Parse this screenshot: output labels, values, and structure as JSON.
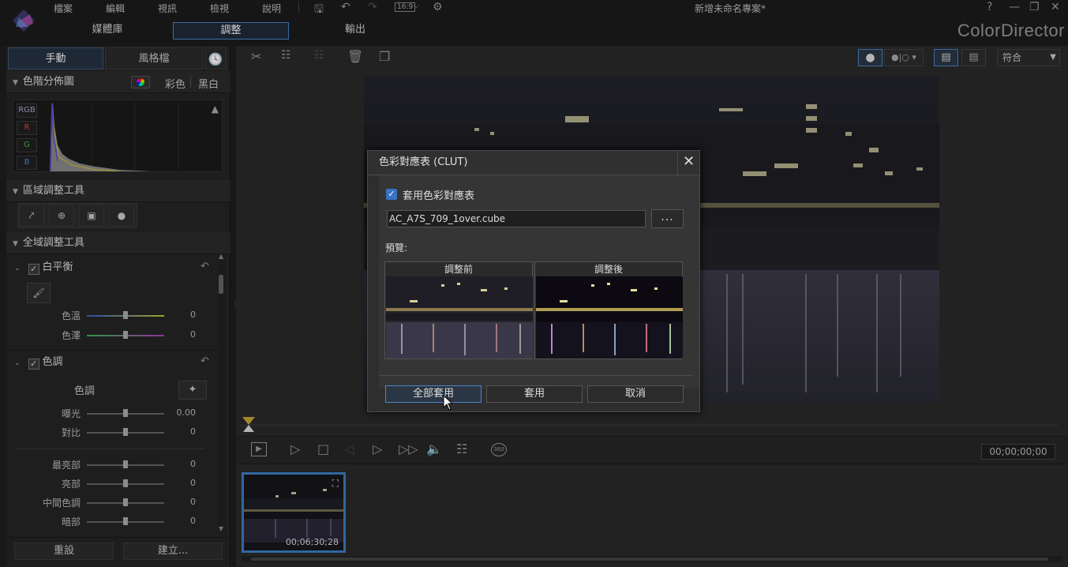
{
  "menu": [
    "檔案",
    "編輯",
    "視訊",
    "檢視",
    "說明"
  ],
  "toolbar_ratio": "16:9",
  "window_title": "新增未命名專案*",
  "window_controls": {
    "help": "?"
  },
  "main_tabs": [
    "媒體庫",
    "調整",
    "輸出"
  ],
  "brand": "ColorDirector",
  "left_tabs": [
    "手動",
    "風格檔"
  ],
  "histogram": {
    "title": "色階分佈圖",
    "mode_color": "彩色",
    "mode_bw": "黑白",
    "channels": [
      "RGB",
      "R",
      "G",
      "B"
    ]
  },
  "regional_tools": {
    "title": "區域調整工具"
  },
  "global_tools": {
    "title": "全域調整工具",
    "white_balance": {
      "title": "白平衡",
      "sliders": [
        {
          "label": "色溫",
          "value": "0"
        },
        {
          "label": "色澤",
          "value": "0"
        }
      ]
    },
    "tone": {
      "title": "色調",
      "subtitle": "色調",
      "sliders": [
        {
          "label": "曝光",
          "value": "0.00"
        },
        {
          "label": "對比",
          "value": "0"
        },
        {
          "label": "最亮部",
          "value": "0"
        },
        {
          "label": "亮部",
          "value": "0"
        },
        {
          "label": "中間色調",
          "value": "0"
        },
        {
          "label": "暗部",
          "value": "0"
        }
      ]
    }
  },
  "bottom_buttons": {
    "reset": "重設",
    "create": "建立..."
  },
  "view_fit": "符合",
  "timecode": "00;00;00;00",
  "clip": {
    "duration": "00;06;30;28"
  },
  "dialog": {
    "title": "色彩對應表 (CLUT)",
    "apply_check_label": "套用色彩對應表",
    "file_value": "AC_A7S_709_1over.cube",
    "browse_label": "...",
    "preview_label": "預覽:",
    "before_label": "調整前",
    "after_label": "調整後",
    "apply_all": "全部套用",
    "apply": "套用",
    "cancel": "取消"
  },
  "colors": {
    "accent": "#4a86c8",
    "panel": "#252525",
    "dialog": "#2e2e2e"
  }
}
